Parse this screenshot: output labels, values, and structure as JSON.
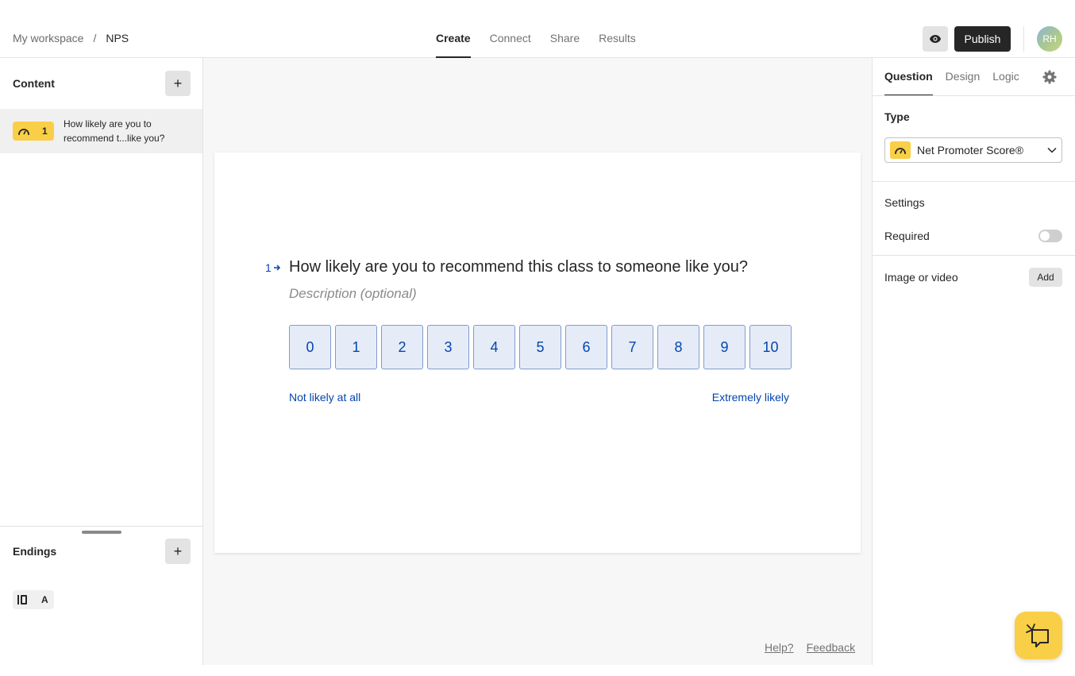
{
  "breadcrumb": {
    "workspace": "My workspace",
    "separator": "/",
    "current": "NPS"
  },
  "nav": {
    "tabs": [
      "Create",
      "Connect",
      "Share",
      "Results"
    ],
    "active": "Create"
  },
  "header": {
    "publish_label": "Publish",
    "avatar_initials": "RH"
  },
  "sidebar": {
    "content_title": "Content",
    "items": [
      {
        "number": "1",
        "text": "How likely are you to recommend t...like you?"
      }
    ],
    "endings_title": "Endings",
    "ending_letter": "A"
  },
  "question": {
    "number": "1",
    "title": "How likely are you to recommend this class to someone like you?",
    "description_placeholder": "Description (optional)",
    "scale": [
      "0",
      "1",
      "2",
      "3",
      "4",
      "5",
      "6",
      "7",
      "8",
      "9",
      "10"
    ],
    "label_left": "Not likely at all",
    "label_right": "Extremely likely"
  },
  "footer": {
    "help": "Help?",
    "feedback": "Feedback"
  },
  "panel": {
    "tabs": [
      "Question",
      "Design",
      "Logic"
    ],
    "active_tab": "Question",
    "type_label": "Type",
    "type_value": "Net Promoter Score®",
    "settings_label": "Settings",
    "required_label": "Required",
    "required_on": false,
    "media_label": "Image or video",
    "media_add": "Add"
  },
  "colors": {
    "accent_yellow": "#f9cf48",
    "answer_blue": "#0445af",
    "dark": "#262627"
  }
}
